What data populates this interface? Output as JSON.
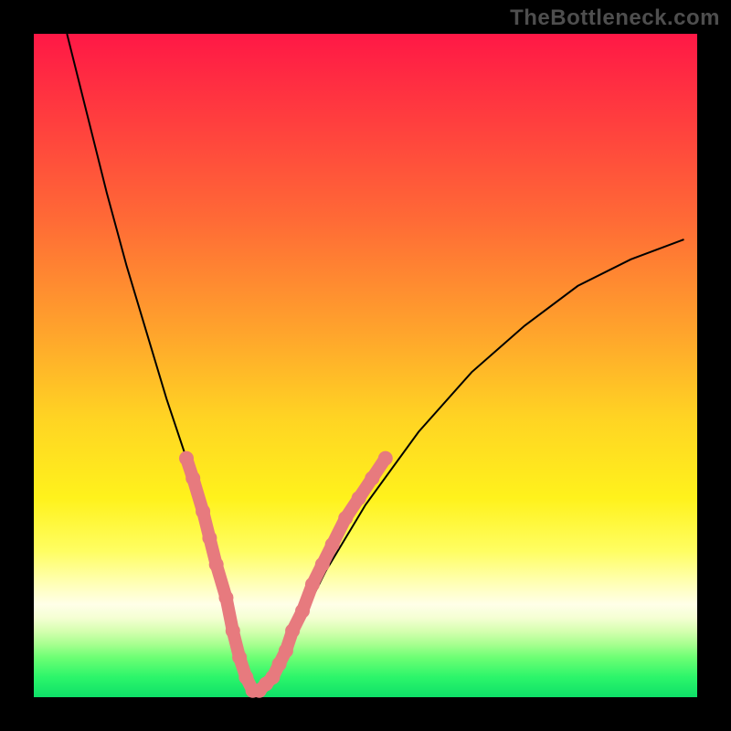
{
  "watermark": "TheBottleneck.com",
  "colors": {
    "frame": "#000000",
    "curve": "#000000",
    "marker": "#e77a7e",
    "gradient_stops": [
      "#ff1846",
      "#ff3540",
      "#ff6a36",
      "#ffa42c",
      "#ffd423",
      "#fff21c",
      "#fffe62",
      "#ffffb8",
      "#ffffe8",
      "#f5ffd4",
      "#d6ffb0",
      "#a8ff90",
      "#6dff74",
      "#2cf56a",
      "#0ee068"
    ]
  },
  "chart_data": {
    "type": "line",
    "title": "",
    "xlabel": "",
    "ylabel": "",
    "xlim": [
      0,
      100
    ],
    "ylim": [
      0,
      100
    ],
    "grid": false,
    "legend": false,
    "note": "Axes are unlabeled; values estimated from pixel positions, normalized 0–100. y=0 is bottom (green), y=100 is top (red/magenta). The curve is a V-shaped valley reaching y≈0 near x≈33.",
    "series": [
      {
        "name": "curve",
        "x": [
          5,
          8,
          11,
          14,
          17,
          20,
          23,
          26,
          29,
          31,
          33,
          35,
          37,
          40,
          44,
          50,
          58,
          66,
          74,
          82,
          90,
          98
        ],
        "y": [
          100,
          88,
          76,
          65,
          55,
          45,
          36,
          27,
          17,
          8,
          1,
          2,
          5,
          11,
          19,
          29,
          40,
          49,
          56,
          62,
          66,
          69
        ]
      }
    ],
    "markers": [
      {
        "name": "highlight-segments",
        "note": "Pink blobby segments overlaid on the curve near the valley.",
        "points": [
          {
            "x": 23,
            "y": 36
          },
          {
            "x": 24,
            "y": 33
          },
          {
            "x": 25.5,
            "y": 28
          },
          {
            "x": 26.5,
            "y": 24
          },
          {
            "x": 27.5,
            "y": 20
          },
          {
            "x": 29,
            "y": 15
          },
          {
            "x": 30,
            "y": 10
          },
          {
            "x": 31,
            "y": 6
          },
          {
            "x": 32,
            "y": 3
          },
          {
            "x": 33,
            "y": 1
          },
          {
            "x": 34,
            "y": 1
          },
          {
            "x": 35,
            "y": 2
          },
          {
            "x": 36,
            "y": 3
          },
          {
            "x": 37,
            "y": 5
          },
          {
            "x": 38,
            "y": 7
          },
          {
            "x": 39,
            "y": 10
          },
          {
            "x": 40.5,
            "y": 13
          },
          {
            "x": 42,
            "y": 17
          },
          {
            "x": 43.5,
            "y": 20
          },
          {
            "x": 45,
            "y": 23
          },
          {
            "x": 47,
            "y": 27
          },
          {
            "x": 49,
            "y": 30
          },
          {
            "x": 51,
            "y": 33
          },
          {
            "x": 53,
            "y": 36
          }
        ]
      }
    ]
  }
}
